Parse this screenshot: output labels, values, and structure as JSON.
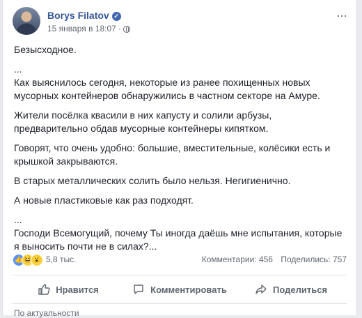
{
  "post": {
    "author": "Borys Filatov",
    "timestamp": "15 января в 18:07",
    "separator": "·",
    "more_label": "···",
    "paragraphs": [
      "Безысходное.",
      "...",
      "Как выяснилось сегодня, некоторые из ранее похищенных новых мусорных контейнеров обнаружились в частном секторе на Амуре.",
      "Жители посёлка квасили в них капусту и солили арбузы, предварительно обдав мусорные контейнеры кипятком.",
      "Говорят, что очень удобно: большие, вместительные, колёсики есть и крышкой закрываются.",
      "В старых металлических солить было нельзя. Негигиенично.",
      "А новые пластиковые как раз подходят.",
      "...",
      "Господи Всемогущий, почему Ты иногда даёшь мне испытания, которые я выносить почти не в силах?..."
    ]
  },
  "stats": {
    "reactions_count": "5,8 тыс.",
    "comments": "Комментарии: 456",
    "shares": "Поделились: 757",
    "reaction_icons": [
      "like-icon",
      "haha-icon",
      "wow-icon"
    ]
  },
  "actions": {
    "like": "Нравится",
    "comment": "Комментировать",
    "share": "Поделиться"
  },
  "footer": {
    "partial_text": "По актуальности"
  },
  "colors": {
    "author": "#365899",
    "verified": "#4267b2",
    "like_reaction": "#5890ff"
  }
}
